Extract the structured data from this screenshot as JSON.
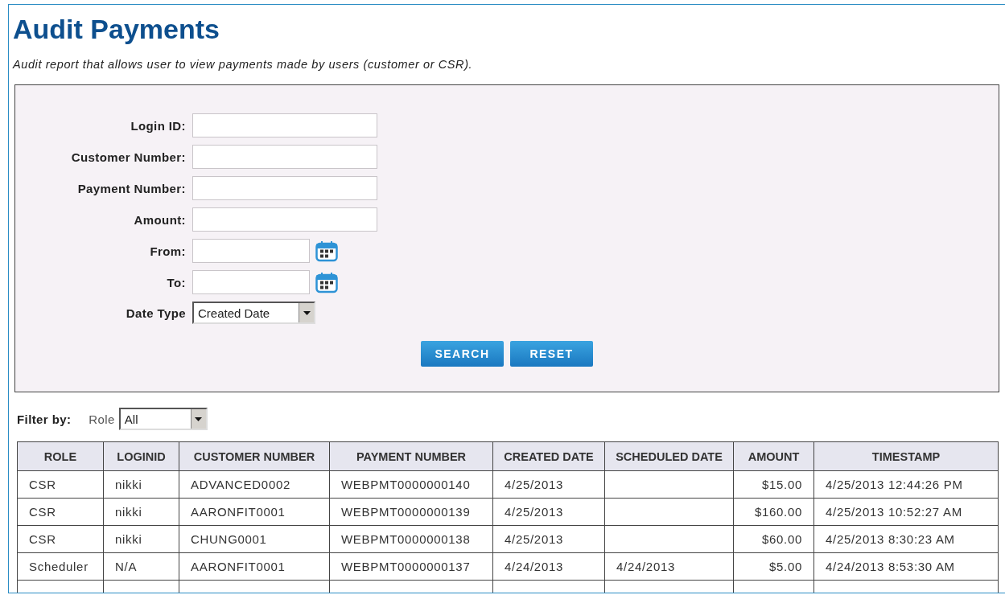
{
  "title": "Audit Payments",
  "description": "Audit report that allows user to view payments made by users (customer or CSR).",
  "search_form": {
    "fields": [
      {
        "label": "Login ID:",
        "kind": "text"
      },
      {
        "label": "Customer Number:",
        "kind": "text"
      },
      {
        "label": "Payment Number:",
        "kind": "text"
      },
      {
        "label": "Amount:",
        "kind": "text"
      },
      {
        "label": "From:",
        "kind": "date"
      },
      {
        "label": "To:",
        "kind": "date"
      },
      {
        "label": "Date Type",
        "kind": "select",
        "value": "Created Date"
      }
    ],
    "buttons": [
      "SEARCH",
      "RESET"
    ]
  },
  "filter": {
    "label": "Filter by:",
    "role_label": "Role",
    "role_value": "All"
  },
  "table": {
    "columns": [
      {
        "label": "ROLE",
        "kind": "text"
      },
      {
        "label": "LOGINID",
        "kind": "text"
      },
      {
        "label": "CUSTOMER NUMBER",
        "kind": "text"
      },
      {
        "label": "PAYMENT NUMBER",
        "kind": "text"
      },
      {
        "label": "CREATED DATE",
        "kind": "text"
      },
      {
        "label": "SCHEDULED DATE",
        "kind": "text"
      },
      {
        "label": "AMOUNT",
        "kind": "amount"
      },
      {
        "label": "TIMESTAMP",
        "kind": "text"
      }
    ],
    "rows": [
      [
        "CSR",
        "nikki",
        "ADVANCED0002",
        "WEBPMT0000000140",
        "4/25/2013",
        "",
        "$15.00",
        "4/25/2013 12:44:26 PM"
      ],
      [
        "CSR",
        "nikki",
        "AARONFIT0001",
        "WEBPMT0000000139",
        "4/25/2013",
        "",
        "$160.00",
        "4/25/2013 10:52:27 AM"
      ],
      [
        "CSR",
        "nikki",
        "CHUNG0001",
        "WEBPMT0000000138",
        "4/25/2013",
        "",
        "$60.00",
        "4/25/2013 8:30:23 AM"
      ],
      [
        "Scheduler",
        "N/A",
        "AARONFIT0001",
        "WEBPMT0000000137",
        "4/24/2013",
        "4/24/2013",
        "$5.00",
        "4/24/2013 8:53:30 AM"
      ]
    ]
  }
}
